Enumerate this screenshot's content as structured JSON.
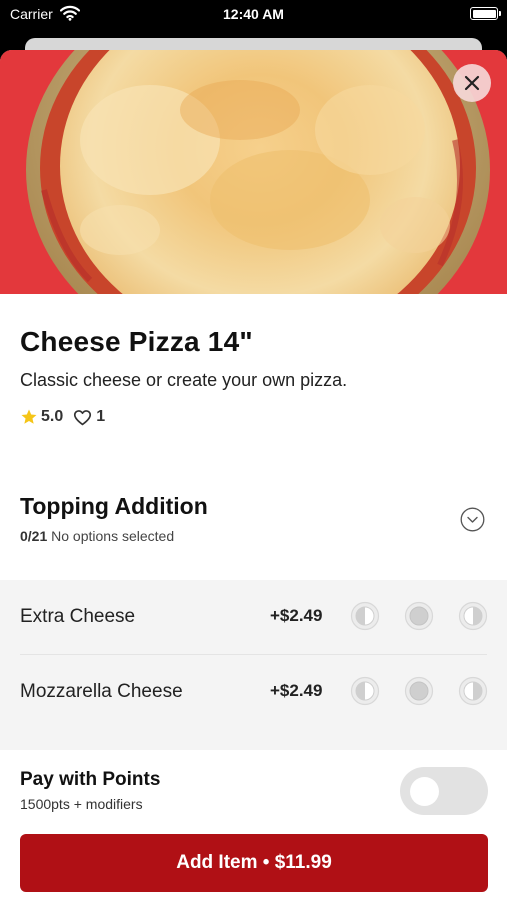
{
  "status_bar": {
    "carrier": "Carrier",
    "time": "12:40 AM"
  },
  "item": {
    "title": "Cheese Pizza 14\"",
    "description": "Classic cheese or create your own pizza.",
    "rating": "5.0",
    "likes": "1"
  },
  "modifier_group": {
    "title": "Topping Addition",
    "count": "0/21",
    "status": "No options selected",
    "options": [
      {
        "name": "Extra Cheese",
        "price": "+$2.49"
      },
      {
        "name": "Mozzarella Cheese",
        "price": "+$2.49"
      }
    ]
  },
  "points": {
    "title": "Pay with Points",
    "subtitle": "1500pts + modifiers",
    "enabled": false
  },
  "cta": {
    "label": "Add Item • $11.99"
  },
  "colors": {
    "brand": "#b01015",
    "hero_background": "#e3383c",
    "star": "#f5c518",
    "toggle_off": "#e2e2e2"
  },
  "icons": {
    "status_bar": [
      "wifi-icon",
      "battery-icon"
    ],
    "hero": [
      "close-icon"
    ],
    "rating": [
      "star-icon",
      "heart-icon"
    ],
    "section": [
      "chevron-down-icon"
    ],
    "portions": [
      "left-half-icon",
      "whole-icon",
      "right-half-icon"
    ]
  }
}
